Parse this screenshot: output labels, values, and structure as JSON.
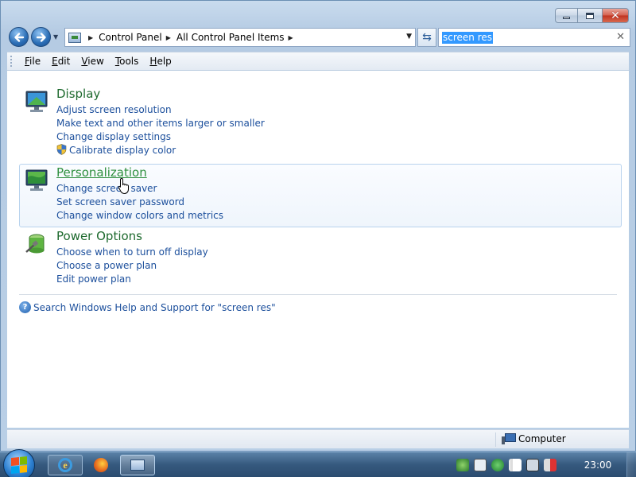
{
  "window": {
    "caption_buttons": [
      "minimize",
      "maximize",
      "close"
    ]
  },
  "nav": {
    "breadcrumbs": [
      "Control Panel",
      "All Control Panel Items"
    ],
    "search_value": "screen res"
  },
  "menu": [
    "File",
    "Edit",
    "View",
    "Tools",
    "Help"
  ],
  "results": [
    {
      "title": "Display",
      "icon": "display-icon",
      "links": [
        "Adjust screen resolution",
        "Make text and other items larger or smaller",
        "Change display settings",
        "Calibrate display color"
      ]
    },
    {
      "title": "Personalization",
      "icon": "personalization-icon",
      "links": [
        "Change screen saver",
        "Set screen saver password",
        "Change window colors and metrics"
      ]
    },
    {
      "title": "Power Options",
      "icon": "power-options-icon",
      "links": [
        "Choose when to turn off display",
        "Choose a power plan",
        "Edit power plan"
      ]
    }
  ],
  "help_link": "Search Windows Help and Support for \"screen res\"",
  "status": {
    "location": "Computer"
  },
  "taskbar": {
    "items": [
      "internet-explorer",
      "firefox",
      "control-panel"
    ],
    "clock": "23:00"
  },
  "colors": {
    "title_green": "#1e6a2e",
    "link_blue": "#1c4f9c",
    "selection": "#3399ff"
  }
}
